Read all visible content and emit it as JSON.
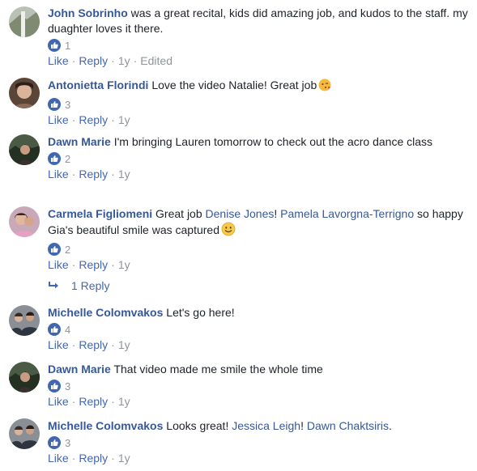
{
  "comments": [
    {
      "author": "John Sobrinho",
      "text": "was a great recital, kids did amazing job, and kudos to the staff. my duaghter loves it there.",
      "reactions": "1",
      "like": "Like",
      "reply": "Reply",
      "time": "1y",
      "edited": "Edited"
    },
    {
      "author": "Antonietta Florindi",
      "text": "Love the video Natalie! Great job",
      "emoji": "face-blowing-kiss",
      "reactions": "3",
      "like": "Like",
      "reply": "Reply",
      "time": "1y"
    },
    {
      "author": "Dawn Marie",
      "text": "I'm bringing Lauren tomorrow to check out the acro dance class",
      "reactions": "2",
      "like": "Like",
      "reply": "Reply",
      "time": "1y"
    },
    {
      "author": "Carmela Figliomeni",
      "text_before": "Great job",
      "mention1": "Denise Jones",
      "text_mid": "!",
      "mention2": "Pamela Lavorgna-Terrigno",
      "text_after": "so happy Gia's beautiful smile was captured",
      "emoji": "smiling-face",
      "reactions": "2",
      "like": "Like",
      "reply": "Reply",
      "time": "1y",
      "replies_link": "1 Reply"
    },
    {
      "author": "Michelle Colomvakos",
      "text": "Let's go here!",
      "reactions": "4",
      "like": "Like",
      "reply": "Reply",
      "time": "1y"
    },
    {
      "author": "Dawn Marie",
      "text": "That video made me smile the whole time",
      "reactions": "3",
      "like": "Like",
      "reply": "Reply",
      "time": "1y"
    },
    {
      "author": "Michelle Colomvakos",
      "text_before": "Looks great!",
      "mention1": "Jessica Leigh",
      "text_mid": "!",
      "mention2": "Dawn Chaktsiris",
      "text_after": ".",
      "reactions": "3",
      "like": "Like",
      "reply": "Reply",
      "time": "1y"
    }
  ],
  "colors": {
    "link": "#365899",
    "action": "#4267b2",
    "meta": "#90949c"
  }
}
